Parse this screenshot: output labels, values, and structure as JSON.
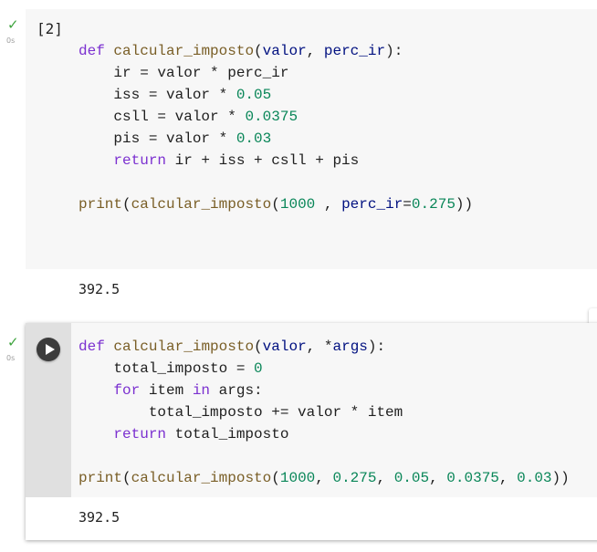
{
  "cells": [
    {
      "exec_count": "[2]",
      "status_icon": "check-icon",
      "duration": "0s",
      "code_lines": [
        "def calcular_imposto(valor, perc_ir):",
        "    ir = valor * perc_ir",
        "    iss = valor * 0.05",
        "    csll = valor * 0.0375",
        "    pis = valor * 0.03",
        "    return ir + iss + csll + pis",
        "",
        "print(calcular_imposto(1000 , perc_ir=0.275))"
      ],
      "output": "392.5"
    },
    {
      "exec_count": "",
      "status_icon": "check-icon",
      "duration": "0s",
      "run_icon": "play-icon",
      "code_lines": [
        "def calcular_imposto(valor, *args):",
        "    total_imposto = 0",
        "    for item in args:",
        "        total_imposto += valor * item",
        "    return total_imposto",
        "",
        "print(calcular_imposto(1000, 0.275, 0.05, 0.0375, 0.03))"
      ],
      "output": "392.5"
    }
  ],
  "colors": {
    "keyword": "#7b30d0",
    "function": "#795e26",
    "param": "#001080",
    "number": "#098658",
    "check": "#3ea43e"
  }
}
